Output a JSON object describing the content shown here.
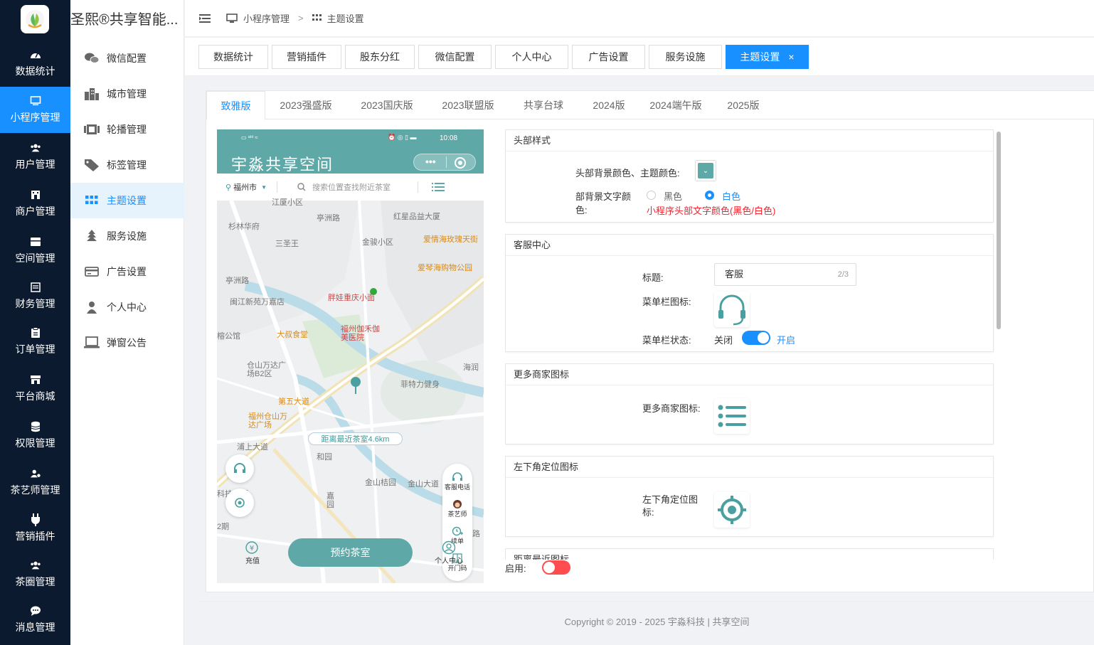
{
  "nav_primary": [
    {
      "label": "数据统计",
      "icon": "dashboard-icon"
    },
    {
      "label": "小程序管理",
      "icon": "monitor-icon"
    },
    {
      "label": "用户管理",
      "icon": "users-icon"
    },
    {
      "label": "商户管理",
      "icon": "shop-icon"
    },
    {
      "label": "空间管理",
      "icon": "box-icon"
    },
    {
      "label": "财务管理",
      "icon": "ledger-icon"
    },
    {
      "label": "订单管理",
      "icon": "clipboard-icon"
    },
    {
      "label": "平台商城",
      "icon": "store-icon"
    },
    {
      "label": "权限管理",
      "icon": "database-icon"
    },
    {
      "label": "茶艺师管理",
      "icon": "user-gear-icon"
    },
    {
      "label": "营销插件",
      "icon": "plug-icon"
    },
    {
      "label": "茶圈管理",
      "icon": "group-icon"
    },
    {
      "label": "消息管理",
      "icon": "chat-icon"
    }
  ],
  "brand": "圣熙®共享智能...",
  "nav_secondary": [
    {
      "label": "微信配置",
      "icon": "wechat-icon"
    },
    {
      "label": "城市管理",
      "icon": "city-icon"
    },
    {
      "label": "轮播管理",
      "icon": "carousel-icon"
    },
    {
      "label": "标签管理",
      "icon": "tag-icon"
    },
    {
      "label": "主题设置",
      "icon": "grid-icon"
    },
    {
      "label": "服务设施",
      "icon": "tree-icon"
    },
    {
      "label": "广告设置",
      "icon": "card-icon"
    },
    {
      "label": "个人中心",
      "icon": "person-icon"
    },
    {
      "label": "弹窗公告",
      "icon": "laptop-icon"
    }
  ],
  "breadcrumb": {
    "level1": "小程序管理",
    "sep": ">",
    "level2": "主题设置"
  },
  "page_tabs": [
    "数据统计",
    "营销插件",
    "股东分红",
    "微信配置",
    "个人中心",
    "广告设置",
    "服务设施",
    "主题设置"
  ],
  "page_tab_close": "×",
  "version_tabs": [
    "致雅版",
    "2023强盛版",
    "2023国庆版",
    "2023联盟版",
    "共享台球",
    "2024版",
    "2024端午版",
    "2025版"
  ],
  "preview": {
    "status_time": "10:08",
    "app_title": "宇淼共享空间",
    "city": "福州市",
    "search_placeholder": "搜索位置查找附近茶室",
    "distance": "距离最近茶室4.6km",
    "book_button": "预约茶室",
    "recharge": "充值",
    "profile": "个人中心",
    "side_items": [
      "客服电话",
      "茶艺师",
      "续单",
      "开门码"
    ],
    "map_labels": [
      "江厦小区",
      "亭洲路",
      "红星品益大厦",
      "杉林华府",
      "金骏小区",
      "爱情海玫瑰天街",
      "三圣王",
      "爱琴海购物公园",
      "亭洲路",
      "闽江新苑万嘉店",
      "胖娃重庆小面",
      "福州伽禾伽美医院",
      "榕公馆",
      "大叔食堂",
      "仓山万达广场B2区",
      "海润",
      "菲特力健身",
      "第五大道",
      "福州仓山万达广场",
      "浦上大道",
      "和园",
      "金山桔园",
      "嘉园",
      "金山大道",
      "杨周东路",
      "2期",
      "科技大厦"
    ]
  },
  "sections": {
    "header_style": {
      "title": "头部样式",
      "bg_color_label": "头部背景颜色、主题颜色:",
      "text_color_label": "部背景文字颜色:",
      "opt_black": "黑色",
      "opt_white": "白色",
      "selected": "白色",
      "hint": "小程序头部文字颜色(黑色/白色)",
      "swatch_color": "#5fa8a8"
    },
    "service": {
      "title": "客服中心",
      "title_label": "标题:",
      "title_value": "客服",
      "title_count": "2/3",
      "icon_label": "菜单栏图标:",
      "status_label": "菜单栏状态:",
      "off": "关闭",
      "on": "开启",
      "enabled": true
    },
    "more_merchants": {
      "title": "更多商家图标",
      "icon_label": "更多商家图标:"
    },
    "locate": {
      "title": "左下角定位图标",
      "icon_label": "左下角定位图标:"
    },
    "nearest": {
      "title": "距离最近图标"
    },
    "enable_label": "启用:"
  },
  "footer": "Copyright © 2019 - 2025 宇淼科技 | 共享空间",
  "colors": {
    "accent": "#1890ff",
    "theme": "#5fa8a8",
    "nav_bg": "#0b1a2e",
    "toggle_off": "#ff4d4f"
  }
}
